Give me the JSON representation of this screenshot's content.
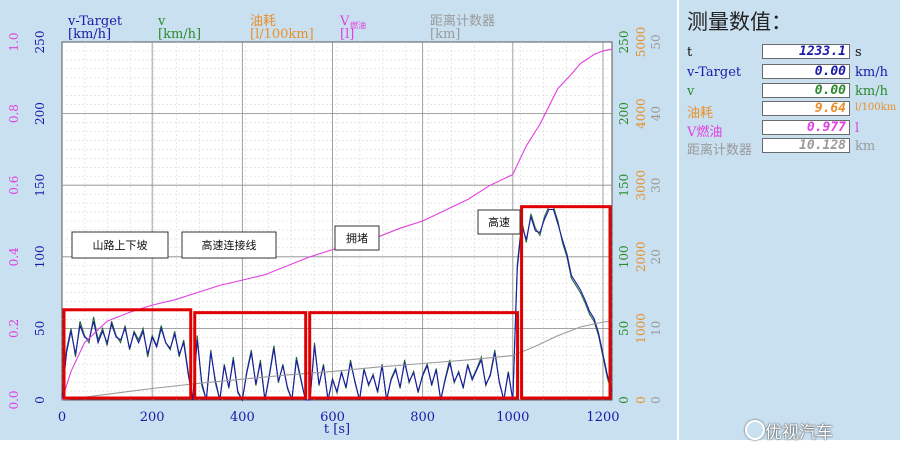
{
  "chart_data": {
    "type": "line",
    "title": "",
    "xlabel": "t [s]",
    "xlim": [
      0,
      1220
    ],
    "x_ticks": [
      0,
      200,
      400,
      600,
      800,
      1000,
      1200
    ],
    "axes": [
      {
        "name": "y-Target",
        "label_line1": "v-Target",
        "label_line2": "[km/h]",
        "color": "#1a1aa8",
        "min": 0,
        "max": 250,
        "ticks": [
          "0",
          "50",
          "100",
          "150",
          "200",
          "250"
        ],
        "side": "left"
      },
      {
        "name": "V_fuel",
        "label_line1": "V",
        "label_sub": "燃油",
        "label_line2": "[l]",
        "color": "#e040e0",
        "min": 0,
        "max": 1.0,
        "ticks": [
          "0.0",
          "0.2",
          "0.4",
          "0.6",
          "0.8",
          "1.0"
        ],
        "side": "left"
      },
      {
        "name": "v",
        "label_line1": "v",
        "label_line2": "[km/h]",
        "color": "#2c8a2c",
        "min": 0,
        "max": 250,
        "ticks": [
          "0",
          "50",
          "100",
          "150",
          "200",
          "250"
        ],
        "side": "right"
      },
      {
        "name": "fuel",
        "label_line1": "油耗",
        "label_line2": "[l/100km]",
        "color": "#e8902a",
        "min": 0,
        "max": 5000,
        "ticks": [
          "0",
          "1000",
          "2000",
          "3000",
          "4000",
          "5000"
        ],
        "side": "right"
      },
      {
        "name": "distance",
        "label_line1": "距离计数器",
        "label_line2": "[km]",
        "color": "#9a9a9a",
        "min": 0,
        "max": 50,
        "ticks": [
          "0",
          "10",
          "20",
          "30",
          "40",
          "50"
        ],
        "side": "right"
      }
    ],
    "series": [
      {
        "name": "v",
        "color": "#2c6a3c",
        "x": [
          0,
          10,
          20,
          30,
          40,
          50,
          60,
          70,
          80,
          90,
          100,
          110,
          120,
          130,
          140,
          150,
          160,
          170,
          180,
          190,
          200,
          210,
          220,
          230,
          240,
          250,
          260,
          270,
          280,
          290,
          300,
          310,
          320,
          330,
          340,
          350,
          360,
          370,
          380,
          390,
          400,
          410,
          420,
          430,
          440,
          450,
          460,
          470,
          480,
          490,
          500,
          510,
          520,
          530,
          540,
          550,
          560,
          570,
          580,
          590,
          600,
          610,
          620,
          630,
          640,
          650,
          660,
          670,
          680,
          690,
          700,
          710,
          720,
          730,
          740,
          750,
          760,
          770,
          780,
          790,
          800,
          810,
          820,
          830,
          840,
          850,
          860,
          870,
          880,
          890,
          900,
          910,
          920,
          930,
          940,
          950,
          960,
          970,
          980,
          990,
          1000,
          1010,
          1020,
          1030,
          1040,
          1050,
          1060,
          1070,
          1080,
          1090,
          1100,
          1110,
          1120,
          1130,
          1140,
          1150,
          1160,
          1170,
          1180,
          1190,
          1200,
          1210,
          1220
        ],
        "y": [
          0,
          35,
          50,
          30,
          55,
          45,
          40,
          58,
          42,
          50,
          38,
          55,
          45,
          40,
          52,
          35,
          48,
          42,
          50,
          30,
          45,
          38,
          52,
          40,
          35,
          48,
          30,
          42,
          20,
          0,
          45,
          10,
          0,
          35,
          12,
          0,
          25,
          8,
          30,
          5,
          0,
          20,
          35,
          10,
          28,
          0,
          18,
          38,
          12,
          25,
          8,
          0,
          30,
          15,
          0,
          0,
          40,
          10,
          25,
          0,
          15,
          5,
          20,
          8,
          28,
          12,
          0,
          22,
          10,
          18,
          5,
          25,
          0,
          15,
          22,
          8,
          28,
          12,
          20,
          5,
          18,
          25,
          10,
          22,
          0,
          15,
          28,
          12,
          20,
          8,
          25,
          15,
          22,
          30,
          10,
          18,
          35,
          12,
          0,
          20,
          0,
          95,
          125,
          110,
          130,
          120,
          115,
          128,
          135,
          135,
          125,
          110,
          100,
          85,
          80,
          75,
          68,
          60,
          55,
          45,
          30,
          15,
          5
        ]
      },
      {
        "name": "v-Target",
        "color": "#1a1aa8",
        "x": [
          0,
          10,
          20,
          30,
          40,
          50,
          60,
          70,
          80,
          90,
          100,
          110,
          120,
          130,
          140,
          150,
          160,
          170,
          180,
          190,
          200,
          210,
          220,
          230,
          240,
          250,
          260,
          270,
          280,
          290,
          300,
          310,
          320,
          330,
          340,
          350,
          360,
          370,
          380,
          390,
          400,
          410,
          420,
          430,
          440,
          450,
          460,
          470,
          480,
          490,
          500,
          510,
          520,
          530,
          540,
          550,
          560,
          570,
          580,
          590,
          600,
          610,
          620,
          630,
          640,
          650,
          660,
          670,
          680,
          690,
          700,
          710,
          720,
          730,
          740,
          750,
          760,
          770,
          780,
          790,
          800,
          810,
          820,
          830,
          840,
          850,
          860,
          870,
          880,
          890,
          900,
          910,
          920,
          930,
          940,
          950,
          960,
          970,
          980,
          990,
          1000,
          1010,
          1020,
          1030,
          1040,
          1050,
          1060,
          1070,
          1080,
          1090,
          1100,
          1110,
          1120,
          1130,
          1140,
          1150,
          1160,
          1170,
          1180,
          1190,
          1200,
          1210,
          1220
        ],
        "y": [
          0,
          33,
          48,
          32,
          52,
          44,
          42,
          55,
          40,
          48,
          40,
          53,
          44,
          42,
          50,
          36,
          47,
          40,
          48,
          32,
          44,
          37,
          50,
          40,
          36,
          46,
          32,
          40,
          18,
          0,
          42,
          12,
          0,
          33,
          14,
          0,
          24,
          9,
          28,
          6,
          0,
          19,
          33,
          11,
          26,
          0,
          17,
          36,
          13,
          24,
          9,
          0,
          28,
          14,
          0,
          0,
          38,
          11,
          24,
          0,
          14,
          6,
          19,
          9,
          26,
          13,
          0,
          21,
          11,
          17,
          6,
          24,
          0,
          14,
          21,
          9,
          26,
          13,
          19,
          6,
          17,
          24,
          11,
          21,
          0,
          14,
          26,
          13,
          19,
          9,
          24,
          14,
          21,
          28,
          11,
          17,
          33,
          13,
          0,
          19,
          0,
          92,
          122,
          112,
          128,
          118,
          117,
          126,
          133,
          133,
          123,
          112,
          102,
          87,
          82,
          77,
          70,
          62,
          57,
          47,
          32,
          17,
          6
        ]
      },
      {
        "name": "V_fuel",
        "color": "#e040e0",
        "x": [
          0,
          20,
          50,
          100,
          150,
          200,
          250,
          300,
          350,
          400,
          450,
          500,
          550,
          600,
          650,
          700,
          750,
          800,
          850,
          900,
          950,
          1000,
          1030,
          1060,
          1100,
          1130,
          1150,
          1180,
          1200,
          1220
        ],
        "y": [
          0,
          0.08,
          0.16,
          0.22,
          0.245,
          0.265,
          0.28,
          0.3,
          0.32,
          0.335,
          0.35,
          0.375,
          0.4,
          0.42,
          0.44,
          0.455,
          0.48,
          0.5,
          0.53,
          0.56,
          0.6,
          0.63,
          0.71,
          0.77,
          0.87,
          0.91,
          0.94,
          0.965,
          0.975,
          0.98
        ]
      },
      {
        "name": "distance",
        "color": "#9a9a9a",
        "x": [
          0,
          100,
          200,
          300,
          400,
          500,
          600,
          700,
          800,
          900,
          1000,
          1050,
          1100,
          1150,
          1200,
          1220
        ],
        "y": [
          0,
          0.8,
          1.6,
          2.3,
          2.9,
          3.5,
          4.0,
          4.6,
          5.1,
          5.6,
          6.2,
          7.5,
          9.0,
          10.2,
          10.9,
          11.0
        ]
      }
    ],
    "annotations": [
      "山路上下坡",
      "高速连接线",
      "拥堵",
      "高速"
    ],
    "highlight_boxes": [
      {
        "x0": 0,
        "x1": 290,
        "y0": 0,
        "y1": 63
      },
      {
        "x0": 290,
        "x1": 545,
        "y0": 0,
        "y1": 61
      },
      {
        "x0": 545,
        "x1": 1015,
        "y0": 0,
        "y1": 61
      },
      {
        "x0": 1015,
        "x1": 1220,
        "y0": 0,
        "y1": 135
      }
    ],
    "grid": true
  },
  "readout": {
    "title": "测量数值：",
    "rows": [
      {
        "label": "t",
        "value": "1233.1",
        "unit": "s",
        "color": "#1a1aa8",
        "label_color": "#111"
      },
      {
        "label": "v-Target",
        "value": "0.00",
        "unit": "km/h",
        "color": "#1a1aa8",
        "label_color": "#1a1aa8"
      },
      {
        "label": "v",
        "value": "0.00",
        "unit": "km/h",
        "color": "#2c8a2c",
        "label_color": "#2c8a2c"
      },
      {
        "label": "油耗",
        "value": "9.64",
        "unit": "l/100km",
        "color": "#e8902a",
        "label_color": "#e8902a"
      },
      {
        "label": "V燃油",
        "value": "0.977",
        "unit": "l",
        "color": "#e040e0",
        "label_color": "#e040e0"
      },
      {
        "label": "距离计数器",
        "value": "10.128",
        "unit": "km",
        "color": "#9a9a9a",
        "label_color": "#9a9a9a"
      }
    ]
  },
  "watermark": "优视汽车"
}
